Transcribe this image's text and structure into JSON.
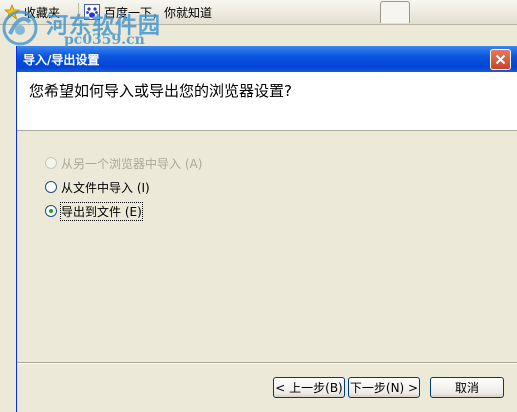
{
  "favorites_bar": {
    "favorites_label": "收藏夹",
    "baidu_link": "百度一下，你就知道"
  },
  "watermark": {
    "name": "河东软件园",
    "url": "pc0359.cn"
  },
  "dialog": {
    "title": "导入/导出设置",
    "question": "您希望如何导入或导出您的浏览器设置?",
    "options": [
      {
        "label": "从另一个浏览器中导入 (A)",
        "enabled": false,
        "checked": false
      },
      {
        "label": "从文件中导入 (I)",
        "enabled": true,
        "checked": false
      },
      {
        "label": "导出到文件 (E)",
        "enabled": true,
        "checked": true
      }
    ],
    "buttons": {
      "back": "< 上一步(B)",
      "next": "下一步(N) >",
      "cancel": "取消"
    }
  },
  "colors": {
    "titlebar": "#0a55df",
    "dialog_bg": "#ece9d8",
    "close_button": "#c8432a",
    "radio_dot": "#21a121",
    "watermark": "#4296d2"
  }
}
